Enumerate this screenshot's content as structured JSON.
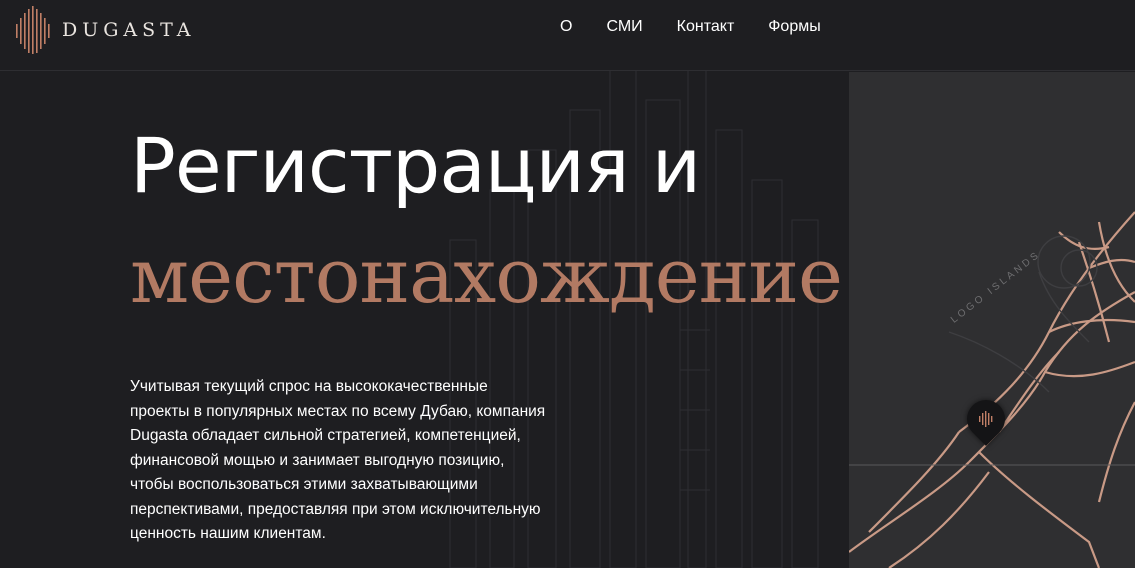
{
  "brand": {
    "name": "DUGASTA",
    "logo_icon": "sound-bars-logo",
    "accent": "#b27a63"
  },
  "nav": {
    "items": [
      "О",
      "СМИ",
      "Контакт",
      "Формы"
    ]
  },
  "hero": {
    "title": "Регистрация и",
    "subtitle": "местонахождение",
    "body": "Учитывая текущий спрос на высококачественные проекты в популярных местах по всему Дубаю, компания Dugasta обладает сильной стратегией, компетенцией, финансовой мощью и занимает выгодную позицию, чтобы воспользоваться этими захватывающими перспективами, предоставляя при этом исключительную ценность нашим клиентам."
  },
  "map": {
    "label": "LOGO ISLANDS",
    "marker_icon": "map-pin-icon"
  },
  "colors": {
    "background": "#1e1e21",
    "map_bg": "#2f2f31",
    "roads": "#c99a86"
  }
}
